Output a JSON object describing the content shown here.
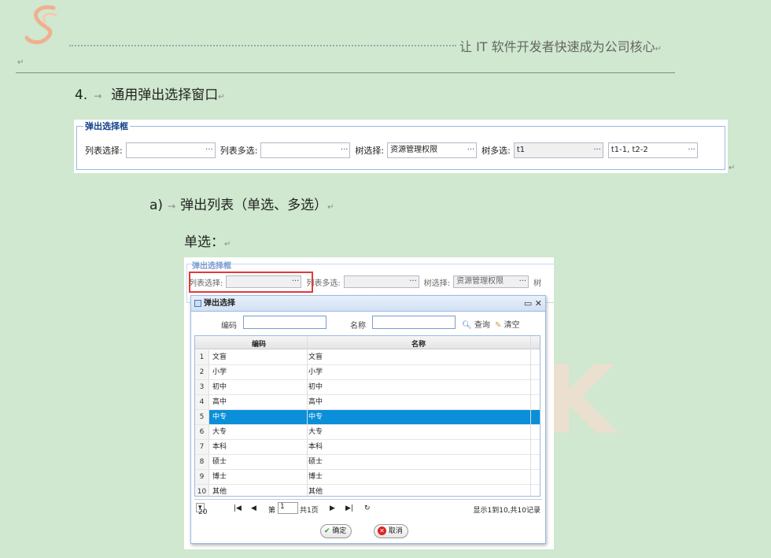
{
  "header": {
    "slogan": "让 IT 软件开发者快速成为公司核心",
    "para_mark": "↵"
  },
  "section": {
    "number": "4.",
    "arrow": "→",
    "title": "通用弹出选择窗口"
  },
  "fieldset": {
    "legend": "弹出选择框",
    "fields": [
      {
        "label": "列表选择:",
        "value": ""
      },
      {
        "label": "列表多选:",
        "value": ""
      },
      {
        "label": "树选择:",
        "value": "资源管理权限"
      },
      {
        "label": "树多选:",
        "value": "t1"
      },
      {
        "label": "",
        "value": "t1-1, t2-2"
      }
    ],
    "trigger": "···"
  },
  "subsection": {
    "prefix": "a)",
    "title": "弹出列表（单选、多选）"
  },
  "single_label": "单选：",
  "screenshot": {
    "legend": "弹出选择框",
    "bg_fields": [
      "列表选择:",
      "列表多选:",
      "树选择:",
      "资源管理权限",
      "树"
    ],
    "dialog": {
      "title": "弹出选择",
      "controls": "▭ ✕",
      "search": {
        "code_label": "编码",
        "name_label": "名称",
        "query_btn": "查询",
        "clear_btn": "清空"
      },
      "columns": [
        "编码",
        "名称"
      ],
      "rows": [
        {
          "n": "1",
          "code": "文盲",
          "name": "文盲"
        },
        {
          "n": "2",
          "code": "小学",
          "name": "小学"
        },
        {
          "n": "3",
          "code": "初中",
          "name": "初中"
        },
        {
          "n": "4",
          "code": "高中",
          "name": "高中"
        },
        {
          "n": "5",
          "code": "中专",
          "name": "中专"
        },
        {
          "n": "6",
          "code": "大专",
          "name": "大专"
        },
        {
          "n": "7",
          "code": "本科",
          "name": "本科"
        },
        {
          "n": "8",
          "code": "硕士",
          "name": "硕士"
        },
        {
          "n": "9",
          "code": "博士",
          "name": "博士"
        },
        {
          "n": "10",
          "code": "其他",
          "name": "其他"
        }
      ],
      "selected_row": 5,
      "pager": {
        "page_size": "20",
        "page_prefix": "第",
        "page": "1",
        "total_pages": "共1页",
        "summary": "显示1到10,共10记录"
      },
      "ok": "确定",
      "cancel": "取消"
    }
  },
  "colors": {
    "selected": "#0a8fd8",
    "highlight": "#e03a3a",
    "background": "#cfe8cf"
  }
}
